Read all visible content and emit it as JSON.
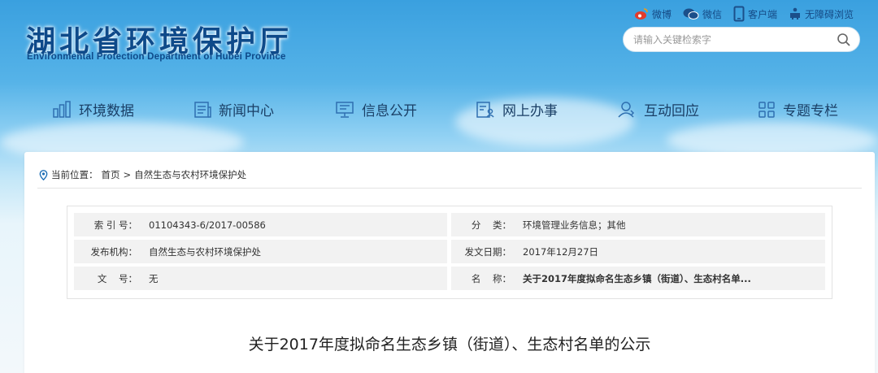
{
  "header": {
    "logo_cn": "湖北省环境保护厅",
    "logo_en": "Environmental Protection Department of Hubei Province",
    "links": [
      {
        "label": "微博",
        "icon": "weibo-icon"
      },
      {
        "label": "微信",
        "icon": "wechat-icon"
      },
      {
        "label": "客户端",
        "icon": "mobile-icon"
      },
      {
        "label": "无障碍浏览",
        "icon": "accessibility-icon"
      }
    ],
    "search_placeholder": "请输入关键检索字"
  },
  "nav": {
    "items": [
      {
        "label": "环境数据",
        "icon": "bar-chart-icon"
      },
      {
        "label": "新闻中心",
        "icon": "news-icon"
      },
      {
        "label": "信息公开",
        "icon": "monitor-icon"
      },
      {
        "label": "网上办事",
        "icon": "form-user-icon"
      },
      {
        "label": "互动回应",
        "icon": "user-icon"
      },
      {
        "label": "专题专栏",
        "icon": "grid-icon"
      }
    ]
  },
  "breadcrumb": {
    "prefix": "当前位置：",
    "home": "首页",
    "separator": ">",
    "current": "自然生态与农村环境保护处"
  },
  "meta": {
    "index_label": "索 引 号：",
    "index_value": "01104343-6/2017-00586",
    "category_label": "分    类：",
    "category_value": "环境管理业务信息；其他",
    "publisher_label": "发布机构：",
    "publisher_value": "自然生态与农村环境保护处",
    "date_label": "发文日期：",
    "date_value": "2017年12月27日",
    "docno_label": "文    号：",
    "docno_value": "无",
    "name_label": "名    称：",
    "name_value": "关于2017年度拟命名生态乡镇（街道）、生态村名单..."
  },
  "document": {
    "title": "关于2017年度拟命名生态乡镇（街道）、生态村名单的公示"
  }
}
